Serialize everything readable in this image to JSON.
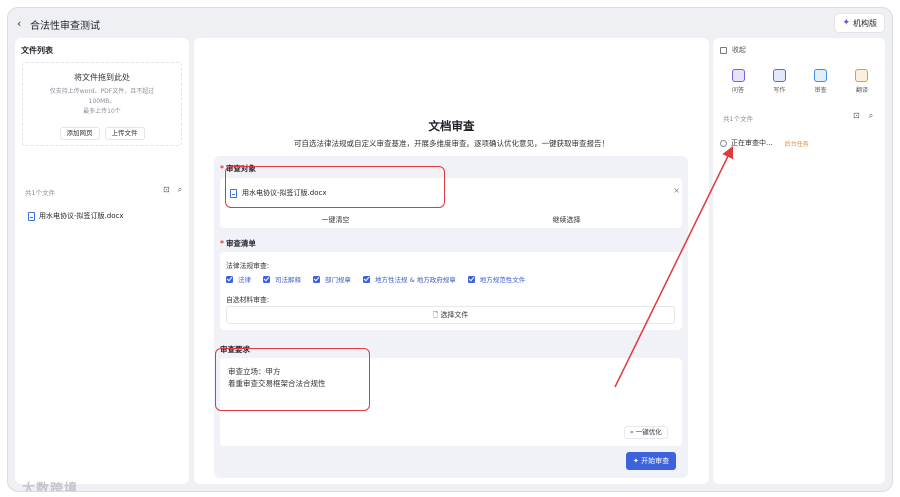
{
  "window": {
    "title": "合法性审查测试",
    "back_icon": "‹",
    "org_button": "机构版",
    "org_icon": "✦"
  },
  "left_panel": {
    "heading": "文件列表",
    "dropzone": {
      "title": "将文件拖到此处",
      "hint": "仅支持上传word、PDF文件，且不超过100MB。",
      "limit": "最多上传10个",
      "add_webpage": "添加网页",
      "upload_file": "上传文件"
    },
    "file_count": "共1个文件",
    "files": [
      "用水电协议-拟签订版.docx"
    ]
  },
  "main": {
    "title": "文档审查",
    "subtitle": "可自选法律法规或自定义审查基准，开展多维度审查。逐项确认优化意见，一键获取审查报告！",
    "target": {
      "label": "审查对象",
      "file": "用水电协议-拟签订版.docx",
      "clear_all": "一键清空",
      "continue_select": "继续选择",
      "remove_icon": "×"
    },
    "checklist": {
      "label": "审查清单",
      "law_title": "法律法规审查:",
      "law_options": [
        "法律",
        "司法解释",
        "部门规章",
        "地方性法规 & 地方政府规章",
        "地方规范性文件"
      ],
      "material_title": "自选材料审查:",
      "select_file": "选择文件"
    },
    "requirements": {
      "label": "审查要求",
      "position": "审查立场：甲方",
      "focus": "着重审查交易框架合法合规性",
      "optimize": "一键优化",
      "start": "开始审查"
    }
  },
  "right_panel": {
    "collapse": "收起",
    "tools": [
      {
        "label": "问答",
        "color": "#7c5cd8"
      },
      {
        "label": "写作",
        "color": "#4a6fe0"
      },
      {
        "label": "审查",
        "color": "#3d8fe0"
      },
      {
        "label": "翻译",
        "color": "#e59a3a"
      }
    ],
    "file_count": "共1个文件",
    "task_status": "正在审查中...",
    "task_tag": "后台任务"
  },
  "watermark": "大数跨境",
  "colors": {
    "accent": "#3d63dc",
    "highlight": "#e0393e",
    "warning": "#e58a2e"
  }
}
